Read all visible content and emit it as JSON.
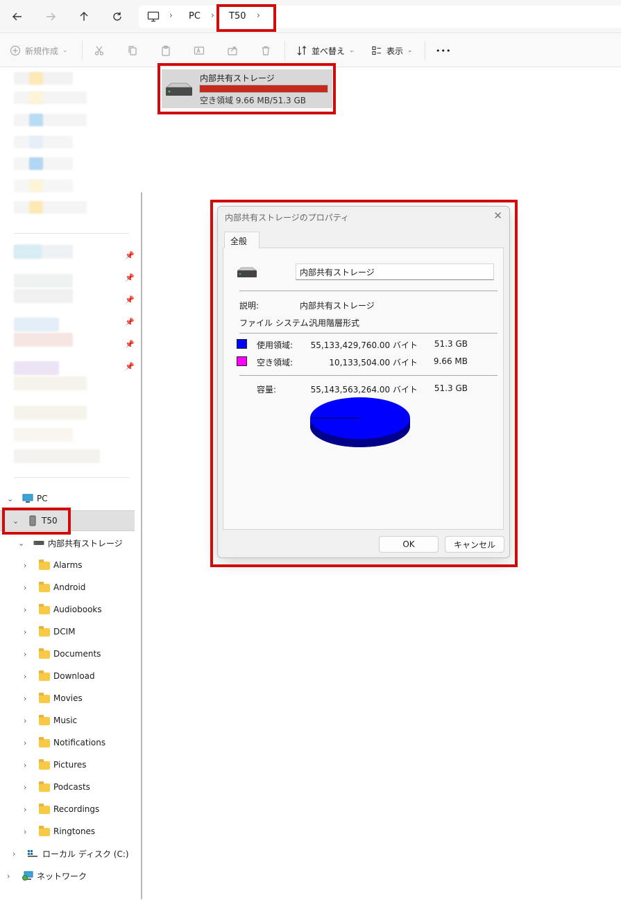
{
  "breadcrumb": {
    "items": [
      "PC",
      "T50"
    ]
  },
  "toolbar": {
    "new_label": "新規作成",
    "sort_label": "並べ替え",
    "view_label": "表示",
    "more_label": "•••"
  },
  "sidebar": {
    "pc_label": "PC",
    "device_label": "T50",
    "storage_label": "内部共有ストレージ",
    "folders": [
      "Alarms",
      "Android",
      "Audiobooks",
      "DCIM",
      "Documents",
      "Download",
      "Movies",
      "Music",
      "Notifications",
      "Pictures",
      "Podcasts",
      "Recordings",
      "Ringtones"
    ],
    "local_disk_label": "ローカル ディスク (C:)",
    "network_label": "ネットワーク"
  },
  "storage_tile": {
    "name": "内部共有ストレージ",
    "free_text": "空き領域 9.66 MB/51.3 GB",
    "used_fraction": 0.9998
  },
  "dialog": {
    "title": "内部共有ストレージのプロパティ",
    "tab_label": "全般",
    "name_value": "内部共有ストレージ",
    "description_label": "説明:",
    "description_value": "内部共有ストレージ",
    "filesystem_label": "ファイル システム:",
    "filesystem_value": "汎用階層形式",
    "used_label": "使用領域:",
    "used_bytes": "55,133,429,760.00 バイト",
    "used_size": "51.3 GB",
    "free_label": "空き領域:",
    "free_bytes": "10,133,504.00 バイト",
    "free_size": "9.66 MB",
    "capacity_label": "容量:",
    "capacity_bytes": "55,143,563,264.00 バイト",
    "capacity_size": "51.3 GB",
    "ok_label": "OK",
    "cancel_label": "キャンセル"
  },
  "colors": {
    "used": "#0000ff",
    "free": "#ff00ff",
    "highlight": "#d10a0a",
    "usage_bar": "#c42b1c"
  }
}
